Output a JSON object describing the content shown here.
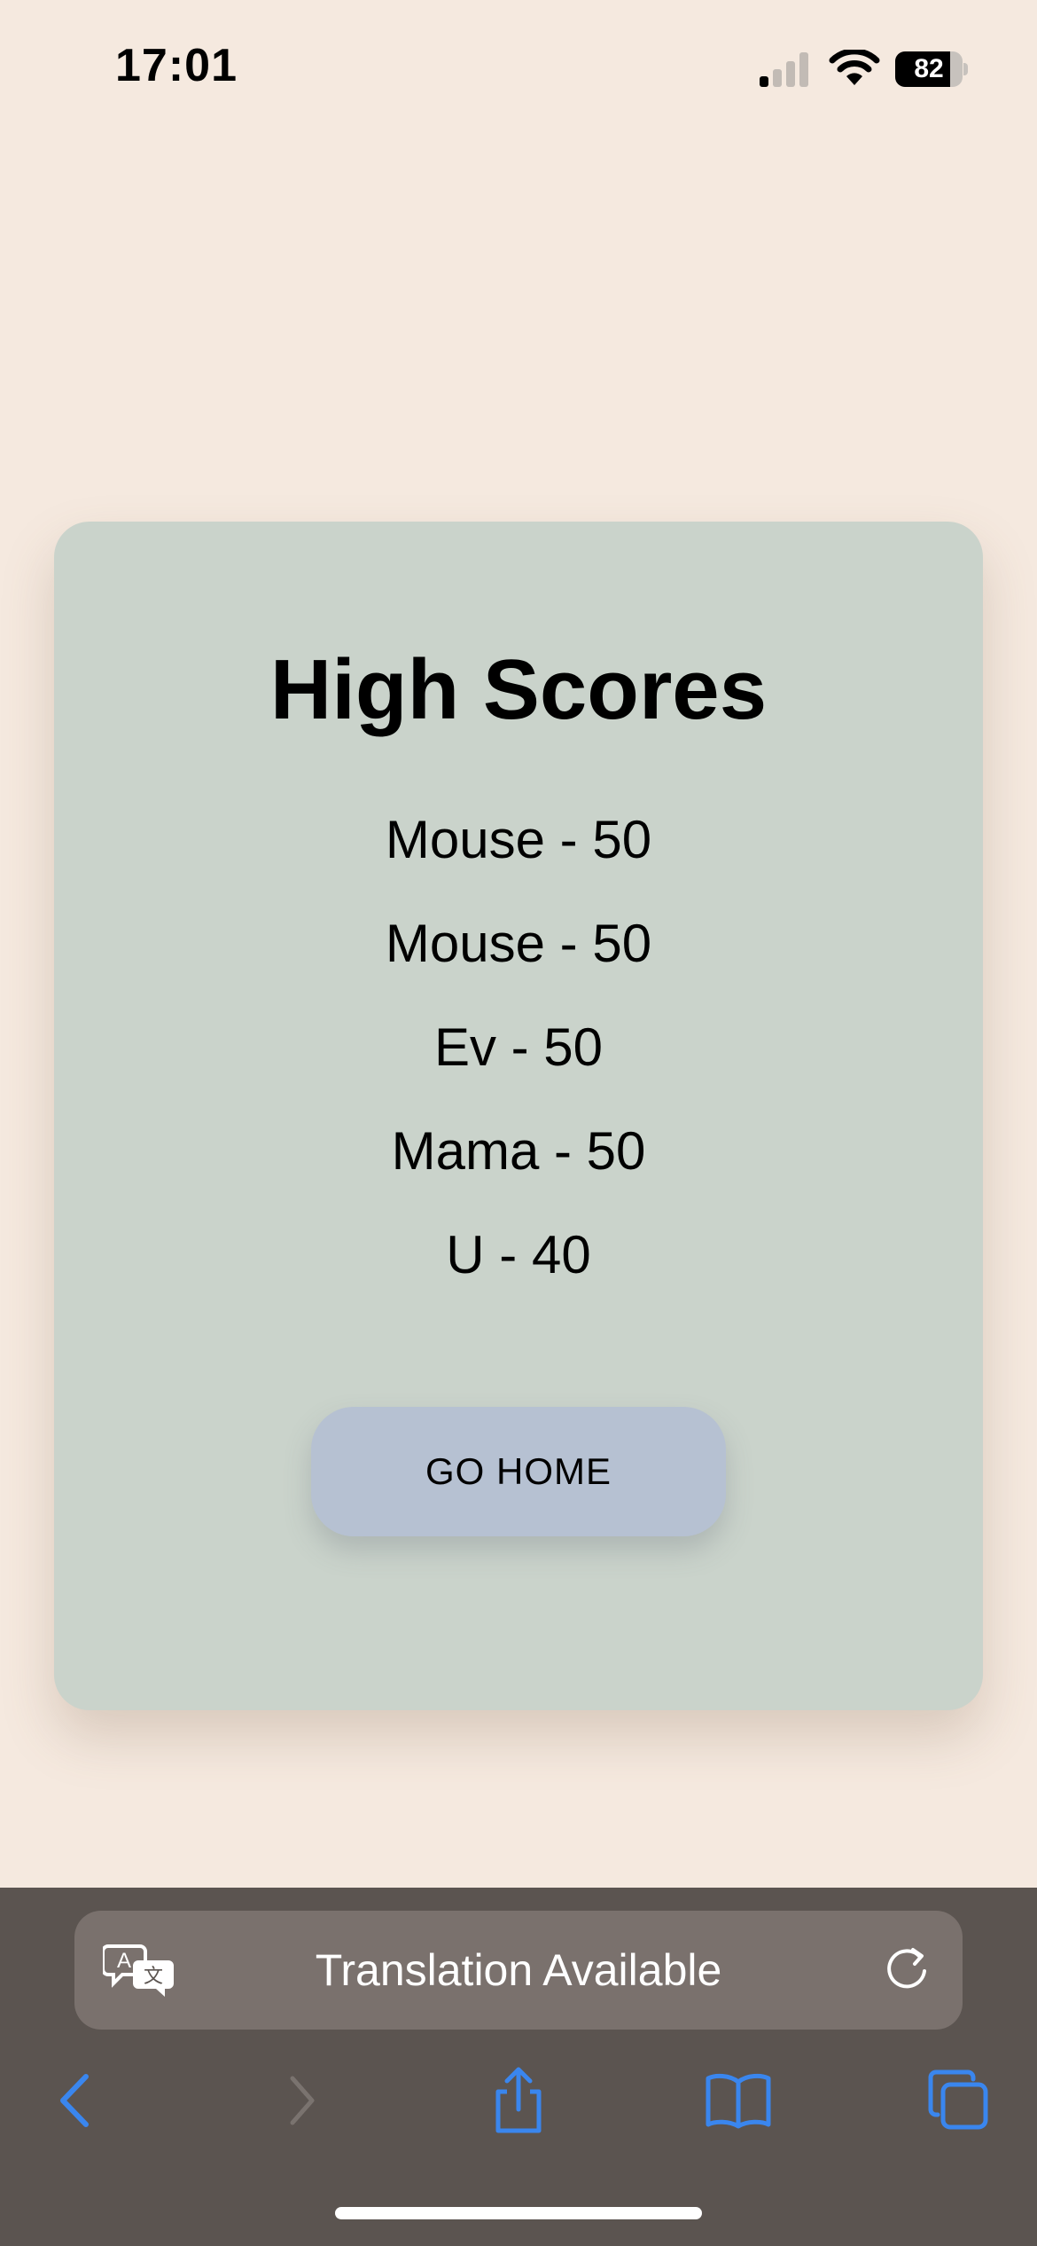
{
  "status_bar": {
    "time": "17:01",
    "battery_level": "82",
    "icons": [
      "signal-icon",
      "wifi-icon",
      "battery-icon"
    ]
  },
  "card": {
    "title": "High Scores",
    "scores": [
      "Mouse - 50",
      "Mouse - 50",
      "Ev - 50",
      "Mama - 50",
      "U - 40"
    ],
    "home_button_label": "GO HOME"
  },
  "browser": {
    "translation_text": "Translation Available",
    "icons": [
      "translate-icon",
      "reload-icon",
      "back-icon",
      "forward-icon",
      "share-icon",
      "bookmarks-icon",
      "tabs-icon"
    ]
  },
  "colors": {
    "page_background": "#f5e9df",
    "card_background": "#cad3cb",
    "button_background": "#b6c1d2",
    "toolbar_background": "#5b5450",
    "accent_blue": "#3a86ee"
  }
}
